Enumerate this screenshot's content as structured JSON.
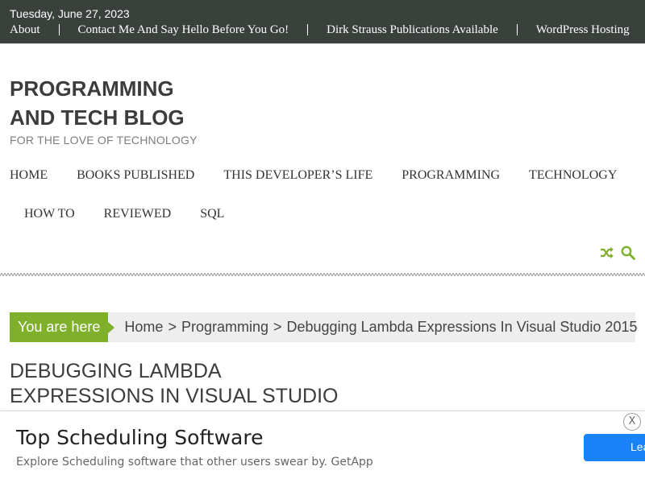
{
  "topbar": {
    "date": "Tuesday, June 27, 2023",
    "links": [
      "About",
      "Contact Me And Say Hello Before You Go!",
      "Dirk Strauss Publications Available",
      "WordPress Hosting"
    ]
  },
  "site": {
    "title_line1": "PROGRAMMING",
    "title_line2": "AND TECH BLOG",
    "tagline": "FOR THE LOVE OF TECHNOLOGY"
  },
  "nav": {
    "row1": [
      "HOME",
      "BOOKS PUBLISHED",
      "THIS DEVELOPER’S LIFE",
      "PROGRAMMING",
      "TECHNOLOGY"
    ],
    "row2": [
      "HOW TO",
      "REVIEWED",
      "SQL"
    ]
  },
  "icons": {
    "shuffle": "shuffle-icon",
    "search": "search-icon",
    "accent": "#7fb02b"
  },
  "breadcrumb": {
    "label": "You are here",
    "items": [
      "Home",
      "Programming",
      "Debugging Lambda Expressions In Visual Studio 2015"
    ],
    "separator": ">"
  },
  "post": {
    "title_line1": "DEBUGGING LAMBDA",
    "title_line2": "EXPRESSIONS IN VISUAL STUDIO"
  },
  "ad": {
    "title": "Top Scheduling Software",
    "description": "Explore Scheduling software that other users swear by. GetApp",
    "button_label": "Lea",
    "close_label": "X",
    "button_color": "#1a82f7"
  }
}
